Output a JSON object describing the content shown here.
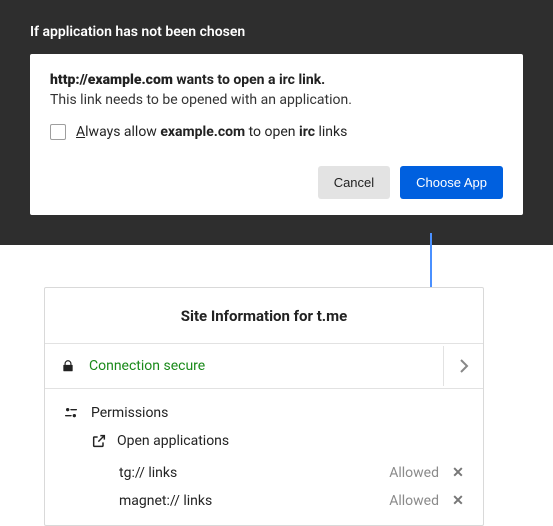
{
  "frame": {
    "title": "If application has not been chosen"
  },
  "dialog": {
    "heading_pre": "http://example.com",
    "heading_post": " wants to open a irc link.",
    "subtext": "This link needs to be opened with an application.",
    "always_pre": "A",
    "always_mid1": "lways allow ",
    "always_site": "example.com",
    "always_mid2": " to open ",
    "always_proto": "irc",
    "always_post": " links",
    "cancel": "Cancel",
    "choose": "Choose App"
  },
  "site": {
    "title": "Site Information for t.me",
    "conn": "Connection secure",
    "perm_label": "Permissions",
    "open_apps": "Open applications",
    "rows": [
      {
        "label": "tg:// links",
        "status": "Allowed"
      },
      {
        "label": "magnet:// links",
        "status": "Allowed"
      }
    ]
  }
}
